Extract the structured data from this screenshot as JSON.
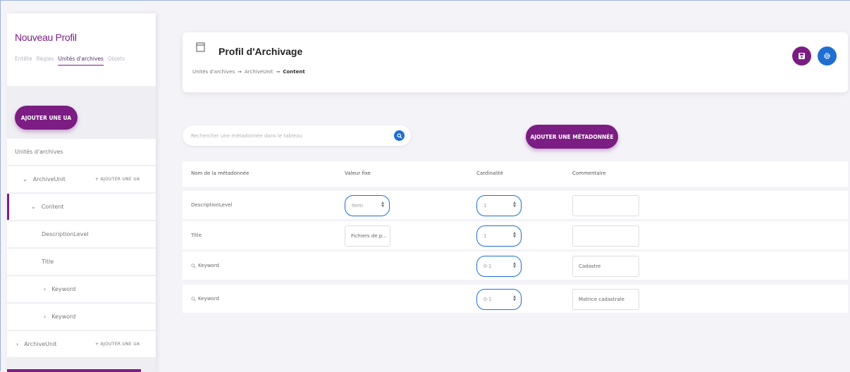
{
  "sidebar": {
    "title": "Nouveau Profil",
    "tabs": [
      "Entête",
      "Règles",
      "Unités d'archives",
      "Objets"
    ],
    "active_tab": 2,
    "add_ua_button": "AJOUTER UNE UA",
    "tree": [
      {
        "label": "Unités d'archives"
      },
      {
        "label": "ArchiveUnit",
        "add": "+ AJOUTER UNE UA",
        "chevron": "⌄"
      },
      {
        "label": "Content",
        "chevron": "⌄",
        "selected": true
      },
      {
        "label": "DescriptionLevel"
      },
      {
        "label": "Title"
      },
      {
        "label": "Keyword",
        "chevron": "›"
      },
      {
        "label": "Keyword",
        "chevron": "›"
      },
      {
        "label": "ArchiveUnit",
        "add": "+ AJOUTER UNE UA",
        "chevron": "›"
      }
    ]
  },
  "header": {
    "title": "Profil d'Archivage",
    "breadcrumb": [
      "Unités d'archives",
      "ArchiveUnit",
      "Content"
    ]
  },
  "search": {
    "placeholder": "Rechercher une métadonnée dans le tableau"
  },
  "add_meta_button": "AJOUTER UNE MÉTADONNÉE",
  "table": {
    "columns": [
      "Nom de la métadonnée",
      "Valeur fixe",
      "Cardinalité",
      "Commentaire"
    ],
    "rows": [
      {
        "name": "DescriptionLevel",
        "fixed": "Item",
        "fixed_type": "select",
        "card": "1",
        "comment": ""
      },
      {
        "name": "Title",
        "fixed": "Fichiers de p...",
        "fixed_type": "text",
        "card": "1",
        "comment": ""
      },
      {
        "name": "Keyword",
        "fixed": "",
        "fixed_type": "none",
        "card": "0-1",
        "comment": "Cadastre",
        "icon": true
      },
      {
        "name": "Keyword",
        "fixed": "",
        "fixed_type": "none",
        "card": "0-1",
        "comment": "Matrice cadastrale",
        "icon": true
      }
    ]
  },
  "colors": {
    "accent": "#7b1d82",
    "primary": "#1e6fd1"
  }
}
